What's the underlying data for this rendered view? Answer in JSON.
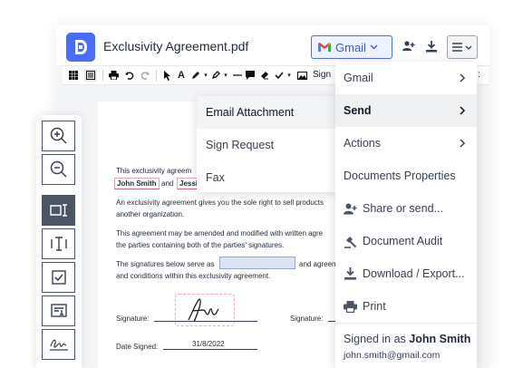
{
  "header": {
    "title": "Exclusivity Agreement.pdf",
    "gmail_label": "Gmail"
  },
  "toolbar": {
    "sign_label": "Sign"
  },
  "document": {
    "line1": "This exclusivity agreem",
    "party1": "John Smith",
    "and": "and",
    "party2": "Jessi",
    "para2_l1": "An exclusivity agreement gives you the sole right to sell products",
    "para2_l2": "another organization.",
    "para3_l1": "This agreement may be amended and modified with written agre",
    "para3_l2": "the parties containing both of the parties' signatures.",
    "para4_l1a": "The signatures below serve as",
    "para4_l1b": "and agreem",
    "para4_l2": "and conditions within this exclusivity agreement.",
    "signature_label": "Signature:",
    "signature2_label": "Signature:",
    "date_label": "Date Signed:",
    "date_value": "31/8/2022"
  },
  "submenu": {
    "items": [
      {
        "label": "Email Attachment"
      },
      {
        "label": "Sign Request"
      },
      {
        "label": "Fax"
      }
    ]
  },
  "mainmenu": {
    "items": [
      {
        "label": "Gmail"
      },
      {
        "label": "Send"
      },
      {
        "label": "Actions"
      },
      {
        "label": "Documents Properties"
      },
      {
        "label": "Share or send..."
      },
      {
        "label": "Document Audit"
      },
      {
        "label": "Download / Export..."
      },
      {
        "label": "Print"
      }
    ],
    "signed_in_prefix": "Signed in as",
    "signed_in_name": "John Smith",
    "email": "john.smith@gmail.com"
  },
  "colors": {
    "brand": "#4a6cf7",
    "gmail_red": "#ea4335"
  }
}
